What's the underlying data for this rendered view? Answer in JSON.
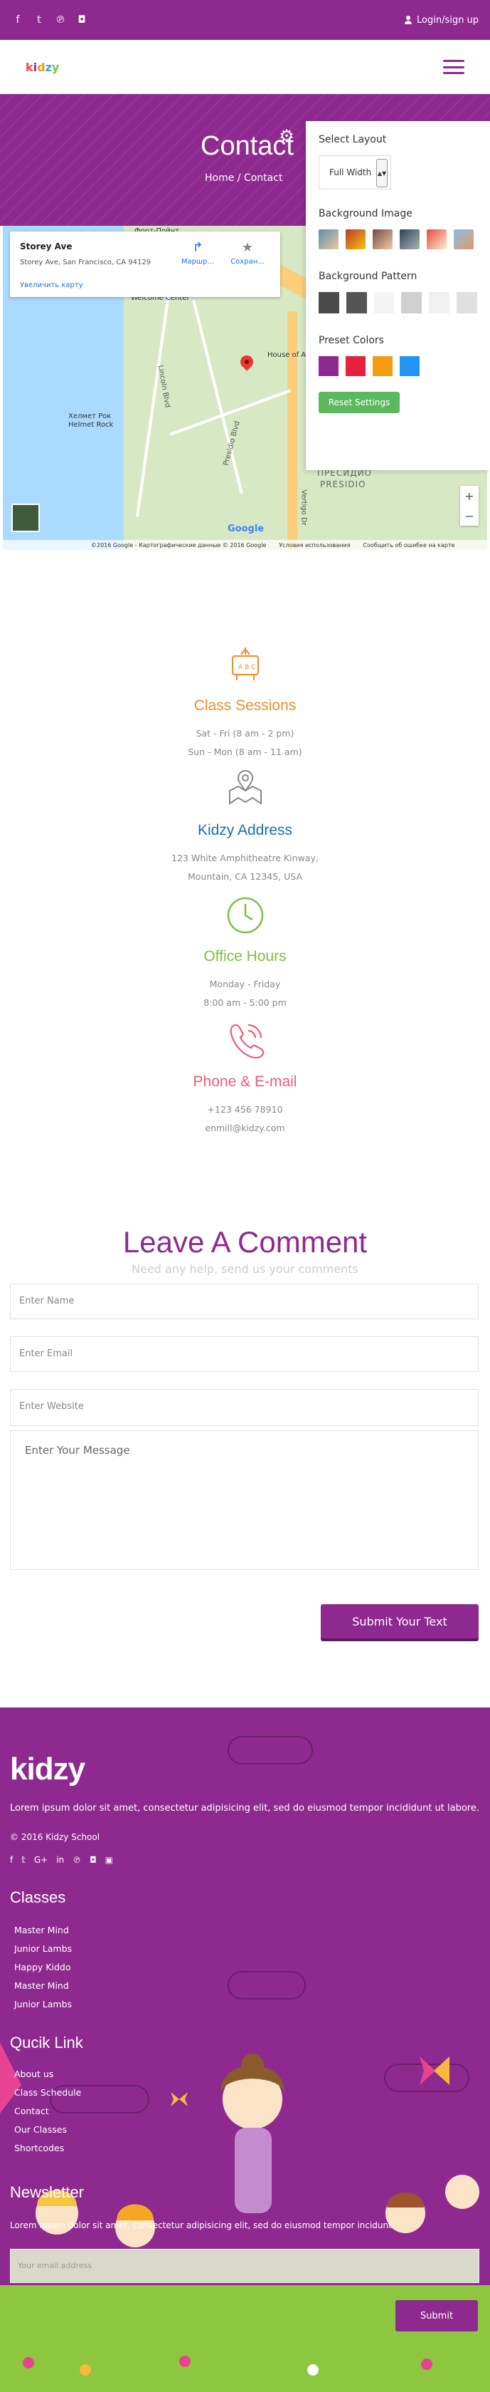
{
  "topbar": {
    "social_icons": [
      "facebook-icon",
      "twitter-icon",
      "pinterest-icon",
      "instagram-icon"
    ],
    "login_label": "Login/sign up"
  },
  "navbar": {
    "logo": "kidzy"
  },
  "hero": {
    "title": "Contact",
    "breadcrumb": "Home / Contact"
  },
  "map": {
    "place_title": "Storey Ave",
    "place_address": "Storey Ave, San Francisco, CA 94129",
    "directions_label": "Маршр...",
    "save_label": "Сохран...",
    "enlarge_label": "Увеличить карту",
    "labels": [
      "Форт-Пойнт",
      "Welcome Center",
      "House of Air",
      "Хелмет Рок",
      "Helmet Rock",
      "ПРЕСИДИО",
      "PRESIDIO",
      "Vertigo Dr",
      "Lincoln Blvd",
      "Presidio Blvd"
    ],
    "brand": "Google",
    "footer": [
      "©2016 Google - Картографические данные © 2016 Google",
      "Условия использования",
      "Сообщить об ошибке на карте"
    ]
  },
  "settings_panel": {
    "layout_title": "Select Layout",
    "layout_value": "Full Width",
    "bg_image_title": "Background Image",
    "bg_pattern_title": "Background Pattern",
    "preset_title": "Preset Colors",
    "preset_colors": [
      "#8e2a8f",
      "#e5213b",
      "#f39c12",
      "#2196f3"
    ],
    "reset_label": "Reset Settings"
  },
  "info": [
    {
      "title": "Class Sessions",
      "color": "#f28c28",
      "lines": [
        "Sat - Fri (8 am - 2 pm)",
        "Sun - Mon (8 am - 11 am)"
      ]
    },
    {
      "title": "Kidzy Address",
      "color": "#1b6fa8",
      "lines": [
        "123 White Amphitheatre Kinway,",
        "Mountain, CA 12345, USA"
      ]
    },
    {
      "title": "Office Hours",
      "color": "#7ac142",
      "lines": [
        "Monday - Friday",
        "8:00 am - 5:00 pm"
      ]
    },
    {
      "title": "Phone & E-mail",
      "color": "#ef5a7a",
      "lines": [
        "+123 456 78910",
        "enmill@kidzy.com"
      ]
    }
  ],
  "comment": {
    "title": "Leave A Comment",
    "subtitle": "Need any help, send us your comments",
    "name_placeholder": "Enter Name",
    "email_placeholder": "Enter Email",
    "website_placeholder": "Enter Website",
    "message_placeholder": "Enter Your Message",
    "submit_label": "Submit Your Text"
  },
  "footer": {
    "logo": "kidzy",
    "about": "Lorem ipsum dolor sit amet, consectetur adipisicing elit, sed do eiusmod tempor incididunt ut labore.",
    "copyright": "© 2016 Kidzy School",
    "social_icons": [
      "facebook-icon",
      "twitter-icon",
      "google-plus-icon",
      "linkedin-icon",
      "pinterest-icon",
      "instagram-icon",
      "flickr-icon"
    ],
    "classes_title": "Classes",
    "classes": [
      "Master Mind",
      "Junior Lambs",
      "Happy Kiddo",
      "Master Mind",
      "Junior Lambs"
    ],
    "quick_title": "Qucik Link",
    "quick_links": [
      "About us",
      "Class Schedule",
      "Contact",
      "Our Classes",
      "Shortcodes"
    ],
    "newsletter_title": "Newsletter",
    "newsletter_text": "Lorem ipsum dolor sit amet, consectetur adipisicing elit, sed do eiusmod tempor incidunt.",
    "newsletter_placeholder": "Your email address",
    "newsletter_button": "Submit"
  }
}
